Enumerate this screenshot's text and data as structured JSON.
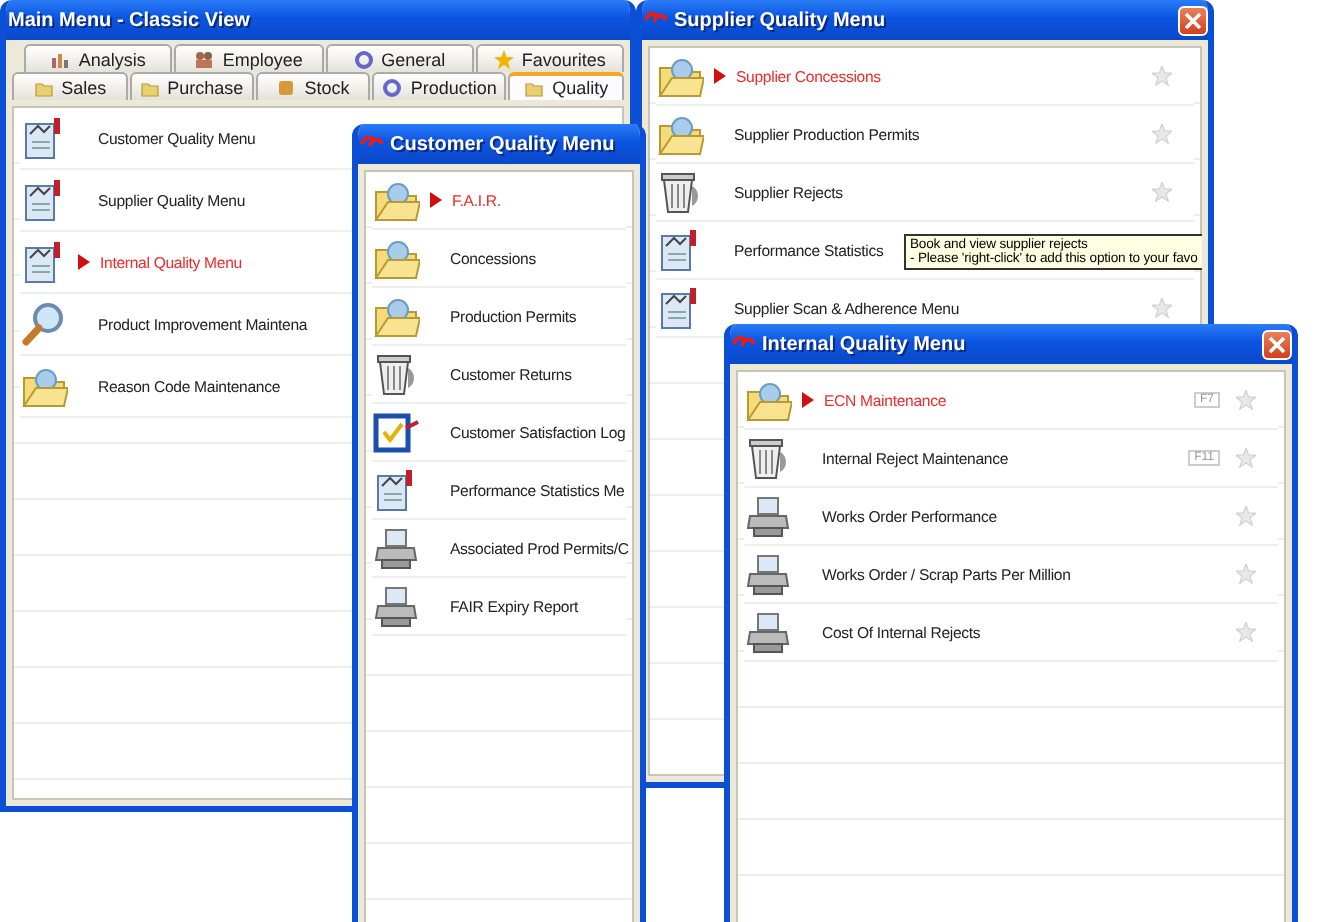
{
  "windows": [
    {
      "title": "Main Menu - Classic View",
      "title_icon": false,
      "close_button": false,
      "show_stars": false,
      "tab_rows": [
        [
          {
            "label": "Analysis",
            "kind": "bars",
            "selected": false
          },
          {
            "label": "Employee",
            "kind": "people",
            "selected": false
          },
          {
            "label": "General",
            "kind": "ring",
            "selected": false
          },
          {
            "label": "Favourites",
            "kind": "star",
            "selected": false
          }
        ],
        [
          {
            "label": "Sales",
            "kind": "folder",
            "selected": false
          },
          {
            "label": "Purchase",
            "kind": "folder",
            "selected": false
          },
          {
            "label": "Stock",
            "kind": "cube",
            "selected": false
          },
          {
            "label": "Production",
            "kind": "ring",
            "selected": false
          },
          {
            "label": "Quality",
            "kind": "folder",
            "selected": true
          }
        ]
      ],
      "rows": [
        {
          "label": "Customer Quality Menu",
          "kind": "report",
          "selected": false
        },
        {
          "label": "Supplier Quality Menu",
          "kind": "report",
          "selected": false
        },
        {
          "label": "Internal Quality Menu",
          "kind": "report",
          "selected": true
        },
        {
          "label": "Product Improvement Maintena",
          "kind": "search",
          "selected": false
        },
        {
          "label": "Reason Code Maintenance",
          "kind": "folder",
          "selected": false
        }
      ]
    },
    {
      "title": "Supplier Quality Menu",
      "title_icon": true,
      "close_button": true,
      "show_stars": true,
      "rows": [
        {
          "label": "Supplier Concessions",
          "kind": "folder",
          "selected": true
        },
        {
          "label": "Supplier Production Permits",
          "kind": "folder",
          "selected": false
        },
        {
          "label": "Supplier Rejects",
          "kind": "bin",
          "selected": false
        },
        {
          "label": "Performance Statistics",
          "kind": "report",
          "selected": false
        },
        {
          "label": "Supplier Scan & Adherence Menu",
          "kind": "report",
          "selected": false
        }
      ]
    },
    {
      "title": "Customer Quality Menu",
      "title_icon": true,
      "close_button": false,
      "show_stars": false,
      "rows": [
        {
          "label": "F.A.I.R.",
          "kind": "folder",
          "selected": true
        },
        {
          "label": "Concessions",
          "kind": "folder",
          "selected": false
        },
        {
          "label": "Production Permits",
          "kind": "folder",
          "selected": false
        },
        {
          "label": "Customer Returns",
          "kind": "bin",
          "selected": false
        },
        {
          "label": "Customer Satisfaction Log",
          "kind": "check",
          "selected": false
        },
        {
          "label": "Performance Statistics Me",
          "kind": "report",
          "selected": false
        },
        {
          "label": "Associated Prod Permits/C",
          "kind": "printer",
          "selected": false
        },
        {
          "label": "FAIR Expiry Report",
          "kind": "printer",
          "selected": false
        }
      ]
    },
    {
      "title": "Internal Quality Menu",
      "title_icon": true,
      "close_button": true,
      "show_stars": true,
      "rows": [
        {
          "label": "ECN Maintenance",
          "kind": "folder",
          "selected": true,
          "shortcut": "F7"
        },
        {
          "label": "Internal Reject Maintenance",
          "kind": "bin",
          "selected": false,
          "shortcut": "F11"
        },
        {
          "label": "Works Order Performance",
          "kind": "printer",
          "selected": false
        },
        {
          "label": "Works Order / Scrap Parts Per Million",
          "kind": "printer",
          "selected": false
        },
        {
          "label": "Cost Of Internal Rejects",
          "kind": "printer",
          "selected": false
        }
      ]
    }
  ],
  "tooltip": {
    "lines": [
      "Book and view supplier rejects",
      "- Please 'right-click' to add this option to your favo"
    ]
  }
}
